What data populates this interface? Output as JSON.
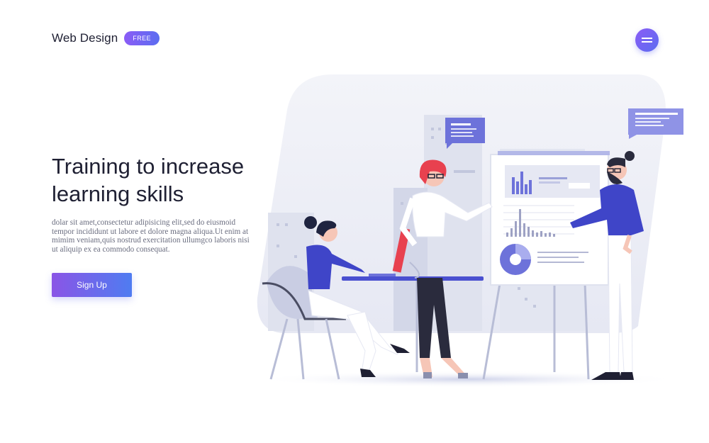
{
  "header": {
    "title": "Web Design",
    "badge": "FREE",
    "menu_icon": "hamburger-icon"
  },
  "hero": {
    "title_line1": "Training to increase",
    "title_line2": "learning skills",
    "body": "dolar sit amet,consectetur adipisicing elit,sed do eiusmoid tempor incididunt ut labore et dolore magna aliqua.Ut enim at mimim veniam,quis nostrud exercitation ullumgco laboris nisi ut aliquip ex ea commodo consequat.",
    "cta_label": "Sign Up"
  },
  "colors": {
    "accent_start": "#8b5cf6",
    "accent_end": "#5b6df0",
    "illustration_bg": "#eef0f7",
    "shirt_blue": "#3f45c8",
    "hair_red": "#e8414f"
  },
  "illustration": {
    "subject": "team-training-presentation",
    "icons": [
      "speech-bubble-icon",
      "bar-chart-icon",
      "pie-chart-icon",
      "presentation-board-icon"
    ]
  }
}
